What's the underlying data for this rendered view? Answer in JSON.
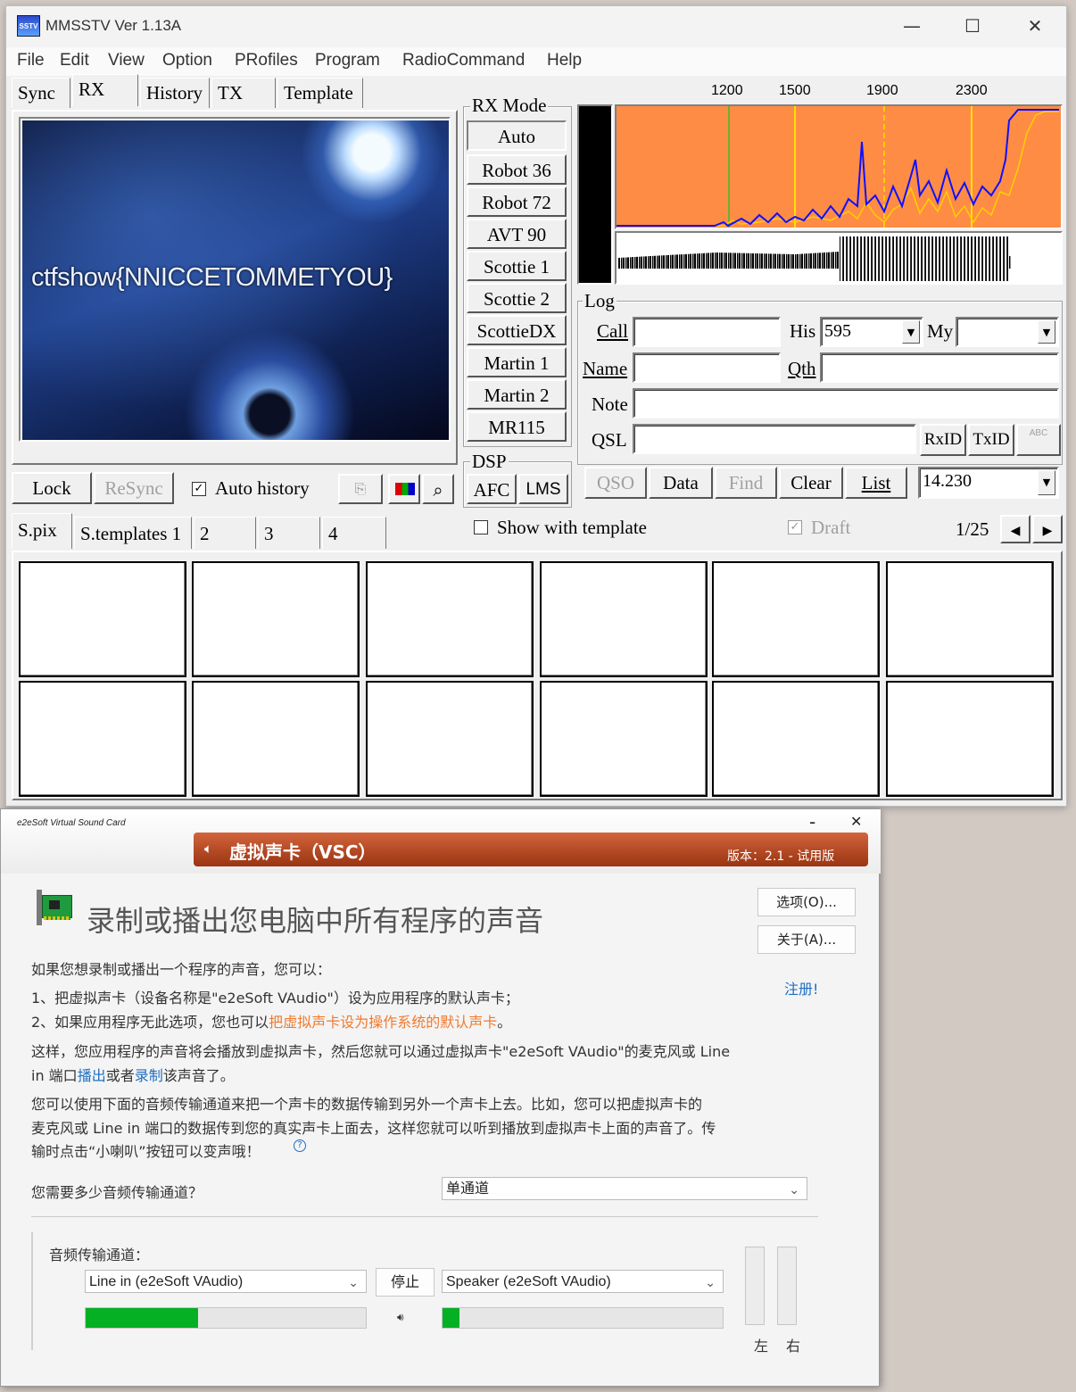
{
  "mmsstv": {
    "title": "MMSSTV Ver 1.13A",
    "icon_text": "SSTV",
    "window_controls": {
      "minimize": "—",
      "maximize": "☐",
      "close": "✕"
    },
    "menu": [
      "File",
      "Edit",
      "View",
      "Option",
      "PRofiles",
      "Program",
      "RadioCommand",
      "Help"
    ],
    "tabs": [
      "Sync",
      "RX",
      "History",
      "TX",
      "Template"
    ],
    "selected_tab": "RX",
    "image_text": "ctfshow{NNICCETOMMETYOU}",
    "rx_mode": {
      "label": "RX Mode",
      "modes": [
        "Auto",
        "Robot 36",
        "Robot 72",
        "AVT 90",
        "Scottie 1",
        "Scottie 2",
        "ScottieDX",
        "Martin 1",
        "Martin 2",
        "MR115"
      ]
    },
    "freq_ticks": [
      "1200",
      "1500",
      "1900",
      "2300"
    ],
    "log": {
      "label": "Log",
      "call_label": "Call",
      "call_value": "",
      "his_label": "His",
      "his_value": "595",
      "my_label": "My",
      "my_value": "",
      "name_label": "Name",
      "name_value": "",
      "qth_label": "Qth",
      "qth_value": "",
      "note_label": "Note",
      "note_value": "",
      "qsl_label": "QSL",
      "qsl_value": "",
      "rxid": "RxID",
      "txid": "TxID",
      "abc": "ABC"
    },
    "rx_buttons": {
      "lock": "Lock",
      "resync": "ReSync",
      "auto_history": "Auto history",
      "auto_history_checked": true
    },
    "dsp": {
      "label": "DSP",
      "afc": "AFC",
      "lms": "LMS"
    },
    "log_buttons": {
      "qso": "QSO",
      "data": "Data",
      "find": "Find",
      "clear": "Clear",
      "list": "List"
    },
    "frequency": "14.230",
    "bottom_tabs": [
      "S.pix",
      "S.templates 1",
      "2",
      "3",
      "4"
    ],
    "show_with_template": "Show with template",
    "draft": "Draft",
    "page": "1/25"
  },
  "vsc": {
    "brand": "e2eSoft Virtual Sound Card",
    "title": "虚拟声卡（VSC）",
    "version": "版本：2.1 - 试用版",
    "minimize": "-",
    "close": "✕",
    "heading": "录制或播出您电脑中所有程序的声音",
    "options_button": "选项(O)...",
    "about_button": "关于(A)...",
    "register_link": "注册!",
    "p1": "如果您想录制或播出一个程序的声音，您可以：",
    "p2": "1、把虚拟声卡（设备名称是\"e2eSoft VAudio\"）设为应用程序的默认声卡；",
    "p3_a": "2、如果应用程序无此选项，您也可以",
    "p3_link": "把虚拟声卡设为操作系统的默认声卡",
    "p3_b": "。",
    "p4_line1": "这样，您应用程序的声音将会播放到虚拟声卡，然后您就可以通过虚拟声卡\"e2eSoft VAudio\"的麦克风或 Line",
    "p4_a": "in 端口",
    "p4_link1": "播出",
    "p4_b": "或者",
    "p4_link2": "录制",
    "p4_c": "该声音了。",
    "p5_line1": "您可以使用下面的音频传输通道来把一个声卡的数据传输到另外一个声卡上去。比如，您可以把虚拟声卡的",
    "p5_line2": "麦克风或 Line in 端口的数据传到您的真实声卡上面去，这样您就可以听到播放到虚拟声卡上面的声音了。传",
    "p5_line3": "输时点击“小喇叭”按钮可以变声哦！",
    "help_icon": "?",
    "channels_question": "您需要多少音频传输通道？",
    "channels_value": "单通道",
    "channel_label": "音频传输通道：",
    "input_device": "Line in (e2eSoft VAudio)",
    "stop_button": "停止",
    "output_device": "Speaker (e2eSoft VAudio)",
    "input_level": 0.4,
    "output_level": 0.06,
    "left_label": "左",
    "right_label": "右",
    "colors": {
      "accent": "#b84a22",
      "link_orange": "#f07a2e",
      "link_blue": "#1f6fc2",
      "meter_green": "#06b025"
    }
  }
}
